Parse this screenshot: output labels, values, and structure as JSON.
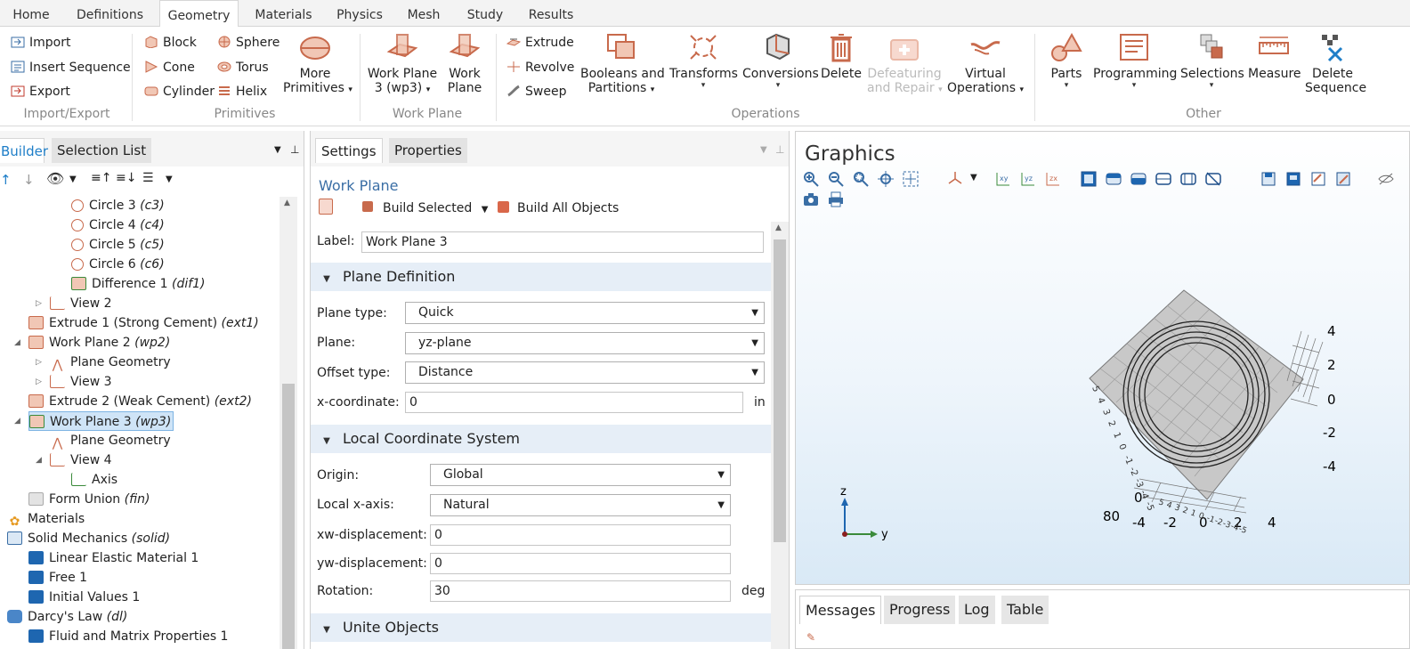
{
  "main_tabs": [
    "Home",
    "Definitions",
    "Geometry",
    "Materials",
    "Physics",
    "Mesh",
    "Study",
    "Results"
  ],
  "active_tab": "Geometry",
  "ribbon": {
    "import_export": {
      "import": "Import",
      "insert_sequence": "Insert Sequence",
      "export": "Export",
      "group": "Import/Export"
    },
    "primitives": {
      "block": "Block",
      "cone": "Cone",
      "cylinder": "Cylinder",
      "sphere": "Sphere",
      "torus": "Torus",
      "helix": "Helix",
      "more_1": "More",
      "more_2": "Primitives",
      "group": "Primitives"
    },
    "work_plane": {
      "wp3_1": "Work Plane",
      "wp3_2": "3 (wp3)",
      "wp_1": "Work",
      "wp_2": "Plane",
      "group": "Work Plane"
    },
    "operations": {
      "extrude": "Extrude",
      "revolve": "Revolve",
      "sweep": "Sweep",
      "booleans_1": "Booleans and",
      "booleans_2": "Partitions",
      "transforms": "Transforms",
      "conversions": "Conversions",
      "delete": "Delete",
      "defeaturing_1": "Defeaturing",
      "defeaturing_2": "and Repair",
      "virtual_1": "Virtual",
      "virtual_2": "Operations",
      "group": "Operations"
    },
    "other": {
      "parts": "Parts",
      "programming": "Programming",
      "selections": "Selections",
      "measure": "Measure",
      "delete_seq_1": "Delete",
      "delete_seq_2": "Sequence",
      "group": "Other"
    }
  },
  "left_panel": {
    "tabs": [
      "Builder",
      "Selection List"
    ],
    "tree": [
      {
        "text": "Circle 3 ",
        "tag": "(c3)"
      },
      {
        "text": "Circle 4 ",
        "tag": "(c4)"
      },
      {
        "text": "Circle 5 ",
        "tag": "(c5)"
      },
      {
        "text": "Circle 6 ",
        "tag": "(c6)"
      },
      {
        "text": "Difference 1 ",
        "tag": "(dif1)"
      },
      {
        "text": "View 2",
        "tag": ""
      },
      {
        "text": "Extrude 1 (Strong Cement) ",
        "tag": "(ext1)"
      },
      {
        "text": "Work Plane 2 ",
        "tag": "(wp2)"
      },
      {
        "text": "Plane Geometry",
        "tag": ""
      },
      {
        "text": "View 3",
        "tag": ""
      },
      {
        "text": "Extrude 2 (Weak  Cement) ",
        "tag": "(ext2)"
      },
      {
        "text": "Work Plane 3 ",
        "tag": "(wp3)"
      },
      {
        "text": "Plane Geometry",
        "tag": ""
      },
      {
        "text": "View 4",
        "tag": ""
      },
      {
        "text": "Axis",
        "tag": ""
      },
      {
        "text": "Form Union ",
        "tag": "(fin)"
      },
      {
        "text": "Materials",
        "tag": ""
      },
      {
        "text": "Solid Mechanics ",
        "tag": "(solid)"
      },
      {
        "text": "Linear Elastic Material 1",
        "tag": ""
      },
      {
        "text": "Free 1",
        "tag": ""
      },
      {
        "text": "Initial Values 1",
        "tag": ""
      },
      {
        "text": "Darcy's Law ",
        "tag": "(dl)"
      },
      {
        "text": "Fluid and Matrix Properties 1",
        "tag": ""
      }
    ]
  },
  "settings": {
    "tabs": [
      "Settings",
      "Properties"
    ],
    "title": "Work Plane",
    "build_selected": "Build Selected",
    "build_all": "Build All Objects",
    "label_caption": "Label:",
    "label_value": "Work Plane 3",
    "plane_definition": "Plane Definition",
    "plane_type_label": "Plane type:",
    "plane_type": "Quick",
    "plane_label": "Plane:",
    "plane": "yz-plane",
    "offset_type_label": "Offset type:",
    "offset_type": "Distance",
    "xcoord_label": "x-coordinate:",
    "xcoord": "0",
    "xcoord_unit": "in",
    "local_cs": "Local Coordinate System",
    "origin_label": "Origin:",
    "origin": "Global",
    "local_x_label": "Local x-axis:",
    "local_x": "Natural",
    "xw_label": "xw-displacement:",
    "xw": "0",
    "yw_label": "yw-displacement:",
    "yw": "0",
    "rotation_label": "Rotation:",
    "rotation": "30",
    "rotation_unit": "deg",
    "unite_objects": "Unite Objects"
  },
  "graphics": {
    "title": "Graphics",
    "right_ticks": [
      "4",
      "2",
      "0",
      "-2",
      "-4"
    ],
    "bottom_ticks": [
      "-4",
      "-2",
      "0",
      "2",
      "4"
    ],
    "left_ticks": [
      "5",
      "4",
      "3",
      "2",
      "1",
      "0",
      "-1",
      "-2",
      "-3",
      "-4",
      "-5"
    ],
    "bottom_left_ticks": [
      "5",
      "4",
      "3",
      "2",
      "1",
      "0",
      "-1",
      "-2",
      "-3",
      "-4",
      "-5"
    ],
    "corner_a": "0",
    "corner_b": "80",
    "axis_z": "z",
    "axis_y": "y"
  },
  "messages": {
    "tabs": [
      "Messages",
      "Progress",
      "Log",
      "Table"
    ]
  },
  "colors": {
    "accent": "#1e7ec8",
    "selection": "#cfe4f7",
    "section_bg": "#e6eef7",
    "icon_orange": "#d9674a"
  }
}
